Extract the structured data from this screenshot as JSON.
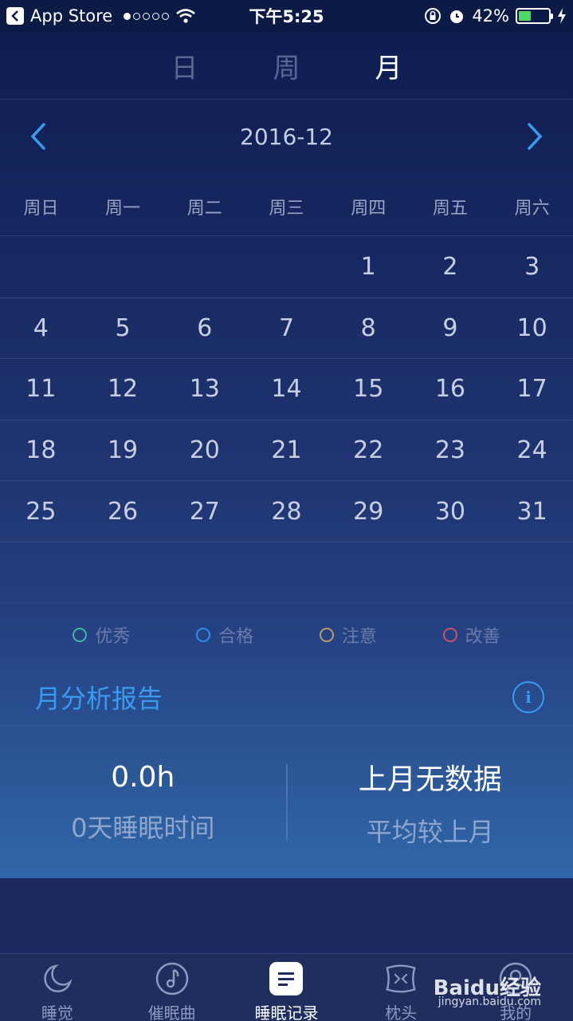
{
  "status_bar": {
    "back_app": "App Store",
    "time": "下午5:25",
    "battery": "42%",
    "battery_level": 0.42,
    "signal_dots_on": 1
  },
  "view_tabs": [
    "日",
    "周",
    "月"
  ],
  "active_view_tab": "月",
  "month_nav": {
    "label": "2016-12"
  },
  "weekdays": [
    "周日",
    "周一",
    "周二",
    "周三",
    "周四",
    "周五",
    "周六"
  ],
  "calendar_rows": [
    [
      "",
      "",
      "",
      "",
      "1",
      "2",
      "3"
    ],
    [
      "4",
      "5",
      "6",
      "7",
      "8",
      "9",
      "10"
    ],
    [
      "11",
      "12",
      "13",
      "14",
      "15",
      "16",
      "17"
    ],
    [
      "18",
      "19",
      "20",
      "21",
      "22",
      "23",
      "24"
    ],
    [
      "25",
      "26",
      "27",
      "28",
      "29",
      "30",
      "31"
    ],
    [
      "",
      "",
      "",
      "",
      "",
      "",
      ""
    ]
  ],
  "legend": [
    {
      "label": "优秀",
      "color": "#3fb8a8"
    },
    {
      "label": "合格",
      "color": "#2f8cf0"
    },
    {
      "label": "注意",
      "color": "#b79b6c"
    },
    {
      "label": "改善",
      "color": "#c9516a"
    }
  ],
  "report": {
    "title": "月分析报告",
    "stats": [
      {
        "value": "0.0h",
        "label": "0天睡眠时间"
      },
      {
        "value": "上月无数据",
        "label": "平均较上月"
      }
    ]
  },
  "tabbar": [
    {
      "label": "睡觉",
      "icon": "moon-icon"
    },
    {
      "label": "催眠曲",
      "icon": "music-note-icon"
    },
    {
      "label": "睡眠记录",
      "icon": "record-icon"
    },
    {
      "label": "枕头",
      "icon": "pillow-icon"
    },
    {
      "label": "我的",
      "icon": "profile-icon"
    }
  ],
  "active_tabbar": "睡眠记录",
  "watermark": {
    "brand": "Baidu经验",
    "url": "jingyan.baidu.com"
  }
}
